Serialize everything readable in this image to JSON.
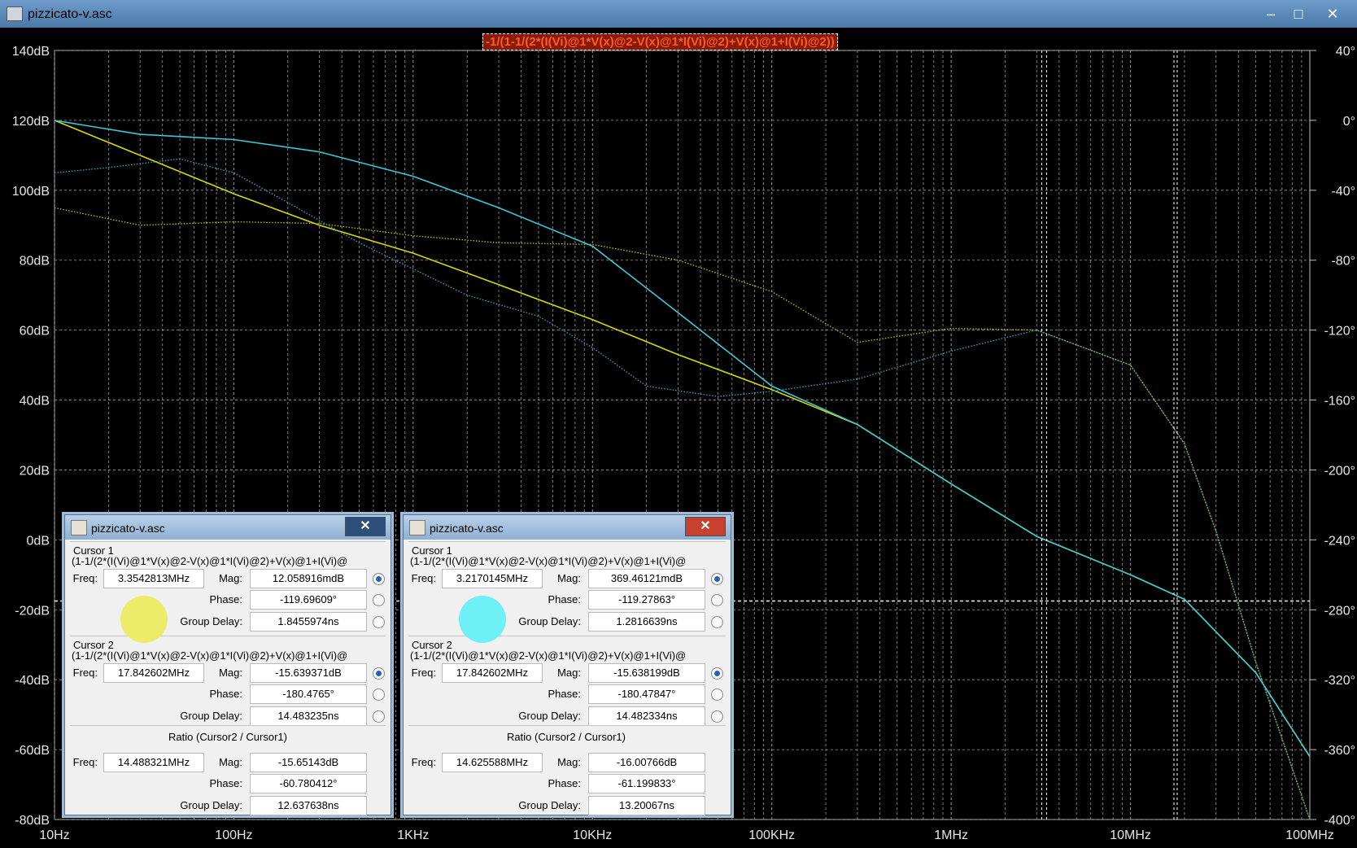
{
  "window": {
    "title": "pizzicato-v.asc",
    "buttons": {
      "minimize": "–",
      "maximize": "□",
      "close": "✕"
    }
  },
  "plot": {
    "title": "-1/(1-1/(2*(I(Vi)@1*V(x)@2-V(x)@1*I(Vi)@2)+V(x)@1+I(Vi)@2))",
    "left_axis_labels": [
      "140dB",
      "120dB",
      "100dB",
      "80dB",
      "60dB",
      "40dB",
      "20dB",
      "0dB",
      "-20dB",
      "-40dB",
      "-60dB",
      "-80dB"
    ],
    "right_axis_labels": [
      "40°",
      "0°",
      "-40°",
      "-80°",
      "-120°",
      "-160°",
      "-200°",
      "-240°",
      "-280°",
      "-320°",
      "-360°",
      "-400°"
    ],
    "x_axis_labels": [
      "10Hz",
      "100Hz",
      "1KHz",
      "10KHz",
      "100KHz",
      "1MHz",
      "10MHz",
      "100MHz"
    ]
  },
  "chart_data": {
    "type": "line",
    "title": "-1/(1-1/(2*(I(Vi)@1*V(x)@2-V(x)@1*I(Vi)@2)+V(x)@1+I(Vi)@2))",
    "x_scale": "log",
    "xlim": [
      10,
      100000000
    ],
    "ylim": [
      -80,
      140
    ],
    "y2lim": [
      -400,
      40
    ],
    "grid": true,
    "colors": {
      "yellow": "#d8d800",
      "cyan": "#3cc8d8",
      "green": "#4ad070",
      "grid": "#9a9a9a"
    },
    "series": [
      {
        "style": "solid",
        "color": "#d8d800",
        "axis": "magnitude",
        "x": [
          10,
          30,
          100,
          300,
          1000,
          3000,
          10000,
          30000,
          100000,
          300000,
          1000000,
          3000000,
          10000000,
          20000000,
          50000000,
          100000000
        ],
        "y": [
          120,
          110,
          99,
          90,
          82,
          73,
          63,
          53,
          43,
          33,
          16,
          1,
          -10,
          -17,
          -38,
          -62
        ]
      },
      {
        "style": "dotted",
        "color": "#b8b800",
        "axis": "phase",
        "x": [
          10,
          30,
          100,
          300,
          1000,
          3000,
          10000,
          30000,
          100000,
          300000,
          1000000,
          3000000,
          10000000,
          20000000,
          30000000,
          50000000,
          100000000
        ],
        "y": [
          -50,
          -60,
          -58,
          -59,
          -66,
          -70,
          -71,
          -80,
          -98,
          -127,
          -119,
          -120,
          -140,
          -185,
          -235,
          -310,
          -400
        ]
      },
      {
        "style": "solid",
        "color": "#3cc8d8",
        "axis": "magnitude",
        "x": [
          10,
          30,
          100,
          300,
          1000,
          3000,
          10000,
          30000,
          100000,
          300000,
          1000000,
          3000000,
          10000000,
          20000000,
          50000000,
          100000000
        ],
        "y": [
          120,
          116,
          114.5,
          111,
          104,
          95,
          84,
          65,
          44,
          33,
          16,
          1,
          -10,
          -17,
          -38,
          -62
        ]
      },
      {
        "style": "dotted",
        "color": "#2aa0b8",
        "axis": "phase",
        "x": [
          10,
          20,
          50,
          100,
          200,
          500,
          1000,
          2000,
          5000,
          10000,
          20000,
          50000,
          100000,
          300000,
          1000000,
          3000000,
          10000000,
          20000000,
          30000000,
          50000000,
          100000000
        ],
        "y": [
          -30,
          -27,
          -22,
          -30,
          -47,
          -70,
          -85,
          -100,
          -112,
          -130,
          -152,
          -158,
          -155,
          -148,
          -132,
          -120,
          -140,
          -185,
          -235,
          -310,
          -400
        ]
      }
    ],
    "cursors": [
      {
        "name": "cursor1",
        "freq_hz": 3300000
      },
      {
        "name": "cursor2",
        "freq_hz": 17842602
      },
      {
        "name": "phase-cursor",
        "value_deg": -275
      }
    ]
  },
  "dialogs": [
    {
      "title": "pizzicato-v.asc",
      "cursor1": {
        "label": "Cursor 1",
        "expr": "(1-1/(2*(I(Vi)@1*V(x)@2-V(x)@1*I(Vi)@2)+V(x)@1+I(Vi)@",
        "freq_label": "Freq:",
        "freq": "3.3542813MHz",
        "mag_label": "Mag:",
        "mag": "12.058916mdB",
        "phase_label": "Phase:",
        "phase": "-119.69609°",
        "gd_label": "Group Delay:",
        "gd": "1.8455974ns"
      },
      "cursor2": {
        "label": "Cursor 2",
        "expr": "(1-1/(2*(I(Vi)@1*V(x)@2-V(x)@1*I(Vi)@2)+V(x)@1+I(Vi)@",
        "freq_label": "Freq:",
        "freq": "17.842602MHz",
        "mag_label": "Mag:",
        "mag": "-15.639371dB",
        "phase_label": "Phase:",
        "phase": "-180.4765°",
        "gd_label": "Group Delay:",
        "gd": "14.483235ns"
      },
      "ratio": {
        "label": "Ratio (Cursor2 / Cursor1)",
        "freq_label": "Freq:",
        "freq": "14.488321MHz",
        "mag_label": "Mag:",
        "mag": "-15.65143dB",
        "phase_label": "Phase:",
        "phase": "-60.780412°",
        "gd_label": "Group Delay:",
        "gd": "12.637638ns"
      },
      "dot_color": "#ecec6a"
    },
    {
      "title": "pizzicato-v.asc",
      "cursor1": {
        "label": "Cursor 1",
        "expr": "(1-1/(2*(I(Vi)@1*V(x)@2-V(x)@1*I(Vi)@2)+V(x)@1+I(Vi)@",
        "freq_label": "Freq:",
        "freq": "3.2170145MHz",
        "mag_label": "Mag:",
        "mag": "369.46121mdB",
        "phase_label": "Phase:",
        "phase": "-119.27863°",
        "gd_label": "Group Delay:",
        "gd": "1.2816639ns"
      },
      "cursor2": {
        "label": "Cursor 2",
        "expr": "(1-1/(2*(I(Vi)@1*V(x)@2-V(x)@1*I(Vi)@2)+V(x)@1+I(Vi)@",
        "freq_label": "Freq:",
        "freq": "17.842602MHz",
        "mag_label": "Mag:",
        "mag": "-15.638199dB",
        "phase_label": "Phase:",
        "phase": "-180.47847°",
        "gd_label": "Group Delay:",
        "gd": "14.482334ns"
      },
      "ratio": {
        "label": "Ratio (Cursor2 / Cursor1)",
        "freq_label": "Freq:",
        "freq": "14.625588MHz",
        "mag_label": "Mag:",
        "mag": "-16.00766dB",
        "phase_label": "Phase:",
        "phase": "-61.199833°",
        "gd_label": "Group Delay:",
        "gd": "13.20067ns"
      },
      "dot_color": "#6ff0f6"
    }
  ]
}
